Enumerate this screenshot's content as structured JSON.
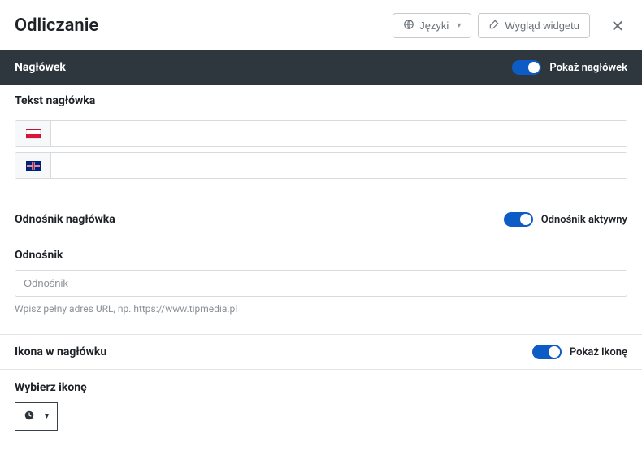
{
  "header": {
    "title": "Odliczanie",
    "languages_btn": "Języki",
    "appearance_btn": "Wygląd widgetu"
  },
  "section_naglowek": {
    "title": "Nagłówek",
    "toggle_label": "Pokaż nagłówek",
    "toggle_on": true,
    "text_label": "Tekst nagłówka",
    "langs": {
      "pl": "",
      "gb": ""
    }
  },
  "section_odnosnik": {
    "title": "Odnośnik nagłówka",
    "toggle_label": "Odnośnik aktywny",
    "toggle_on": true,
    "field_label": "Odnośnik",
    "placeholder": "Odnośnik",
    "value": "",
    "help": "Wpisz pełny adres URL, np. https://www.tipmedia.pl"
  },
  "section_ikona": {
    "title": "Ikona w nagłówku",
    "toggle_label": "Pokaż ikonę",
    "toggle_on": true,
    "picker_label": "Wybierz ikonę",
    "selected_icon": "clock-icon"
  }
}
